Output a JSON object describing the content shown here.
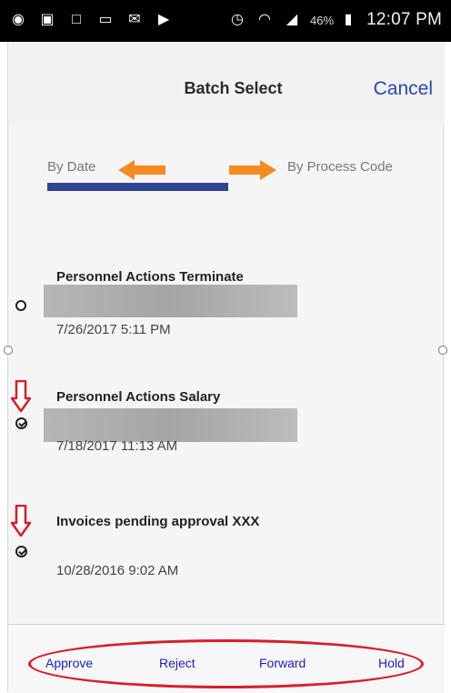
{
  "status_bar": {
    "battery_percent": "46%",
    "time": "12:07 PM",
    "icons": [
      "alarm-icon",
      "image-icon",
      "square-icon",
      "message-icon",
      "mail-icon",
      "play-icon",
      "alarm-clock-icon",
      "wifi-icon",
      "signal-icon",
      "battery-icon"
    ]
  },
  "header": {
    "title": "Batch Select",
    "cancel": "Cancel"
  },
  "tabs": {
    "by_date": "By Date",
    "by_process_code": "By Process Code"
  },
  "items": [
    {
      "title": "Personnel Actions Terminate",
      "time": "7/26/2017 5:11 PM",
      "selected": false
    },
    {
      "title": "Personnel Actions Salary",
      "time": "7/18/2017 11:13 AM",
      "selected": true
    },
    {
      "title": "Invoices pending approval XXX",
      "time": "10/28/2016 9:02 AM",
      "selected": true
    }
  ],
  "actions": {
    "approve": "Approve",
    "reject": "Reject",
    "forward": "Forward",
    "hold": "Hold"
  },
  "colors": {
    "status_bar": "#000000",
    "accent_blue": "#2b46b6",
    "tab_indicator": "#2f4596",
    "annotation_orange": "#f58a1f",
    "annotation_red": "#d71e2a"
  }
}
